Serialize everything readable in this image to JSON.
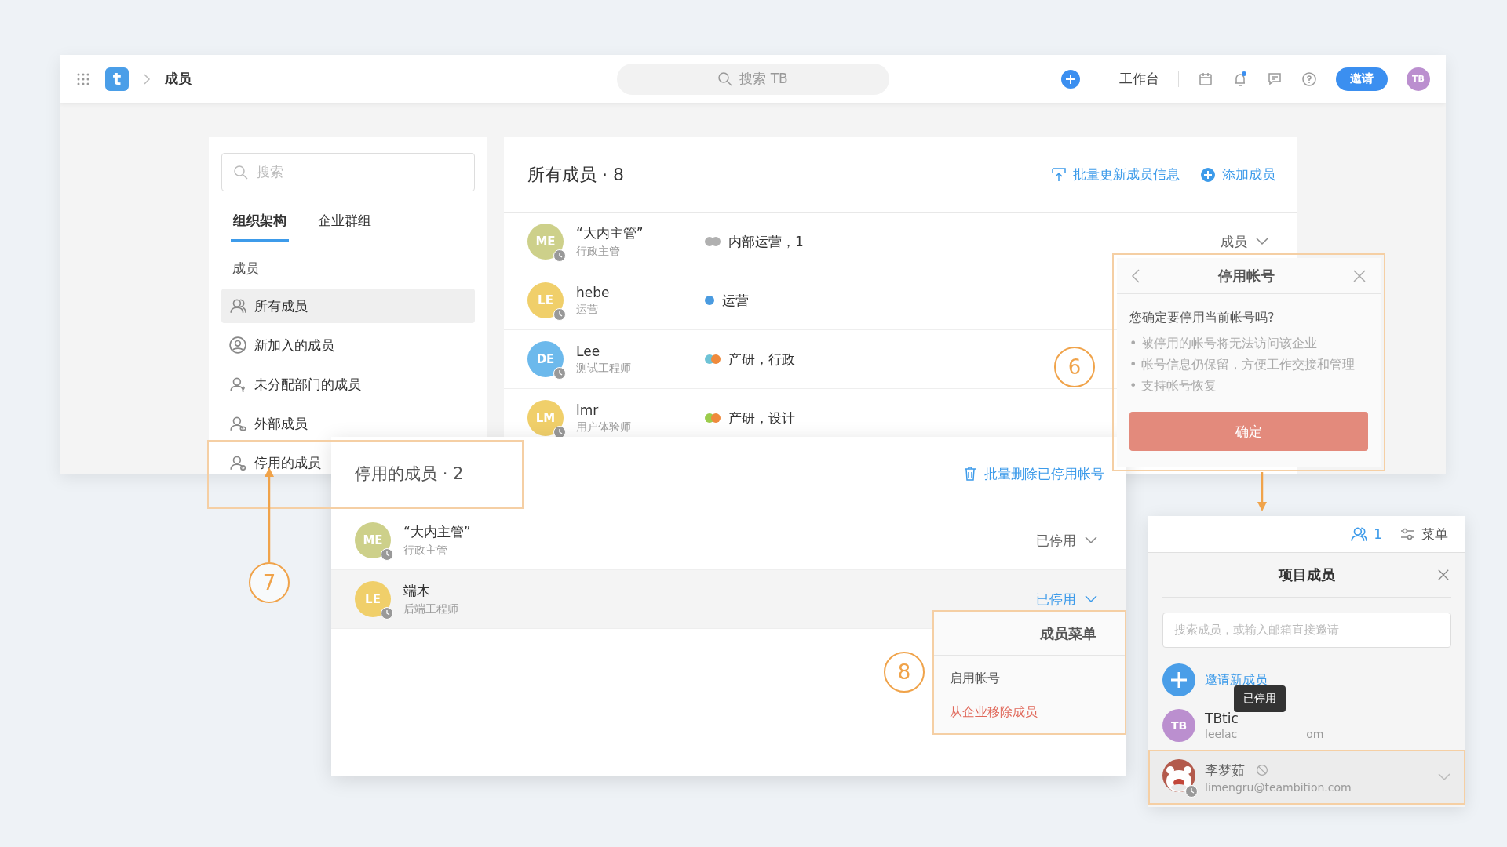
{
  "top_bar": {
    "logo": "t",
    "breadcrumb": "成员",
    "search_placeholder": "搜索 TB",
    "workbench": "工作台",
    "invite": "邀请",
    "avatar": "TB"
  },
  "sidebar": {
    "search_placeholder": "搜索",
    "tabs": [
      {
        "label": "组织架构",
        "selected": true
      },
      {
        "label": "企业群组",
        "selected": false
      }
    ],
    "section": "成员",
    "items": [
      {
        "label": "所有成员",
        "selected": true,
        "kind": "people"
      },
      {
        "label": "新加入的成员",
        "selected": false,
        "kind": "new"
      },
      {
        "label": "未分配部门的成员",
        "selected": false,
        "kind": "unassigned"
      },
      {
        "label": "外部成员",
        "selected": false,
        "kind": "external"
      },
      {
        "label": "停用的成员",
        "selected": false,
        "kind": "disabled"
      }
    ]
  },
  "members_panel": {
    "title": "所有成员 · 8",
    "actions": [
      {
        "label": "批量更新成员信息",
        "kind": "upload"
      },
      {
        "label": "添加成员",
        "kind": "add"
      }
    ],
    "rows": [
      {
        "initials": "ME",
        "color": "#cdd08a",
        "name": "“大内主管”",
        "title": "行政主管",
        "tags": [
          {
            "color": "#b0b0b0"
          },
          {
            "color": "#b0b0b0"
          }
        ],
        "departments": "内部运营，1",
        "role": "成员"
      },
      {
        "initials": "LE",
        "color": "#f0cf6a",
        "name": "hebe",
        "title": "运营",
        "tags": [
          {
            "color": "#4a9be0"
          }
        ],
        "departments": "运营"
      },
      {
        "initials": "DE",
        "color": "#6cb9ec",
        "name": "Lee",
        "title": "测试工程师",
        "tags": [
          {
            "color": "#6ec3d6"
          },
          {
            "color": "#ef8a3c"
          }
        ],
        "departments": "产研，行政"
      },
      {
        "initials": "LM",
        "color": "#f0cf6a",
        "name": "lmr",
        "title": "用户体验师",
        "tags": [
          {
            "color": "#9ccc4c"
          },
          {
            "color": "#ef8a3c"
          }
        ],
        "departments": "产研，设计"
      }
    ]
  },
  "disabled_panel": {
    "title": "停用的成员 · 2",
    "action": "批量删除已停用帐号",
    "rows": [
      {
        "initials": "ME",
        "color": "#cdd08a",
        "name": "“大内主管”",
        "title": "行政主管",
        "status": "已停用",
        "selected": false
      },
      {
        "initials": "LE",
        "color": "#f0cf6a",
        "name": "端木",
        "title": "后端工程师",
        "status": "已停用",
        "selected": true
      }
    ]
  },
  "deactivate_dialog": {
    "title": "停用帐号",
    "question": "您确定要停用当前帐号吗?",
    "bullets": [
      "• 被停用的帐号将无法访问该企业",
      "• 帐号信息仍保留，方便工作交接和管理",
      "• 支持帐号恢复"
    ],
    "confirm": "确定"
  },
  "member_menu": {
    "title": "成员菜单",
    "items": [
      {
        "label": "启用帐号",
        "kind": "normal"
      },
      {
        "label": "从企业移除成员",
        "kind": "danger"
      }
    ]
  },
  "project_panel": {
    "member_count": "1",
    "menu": "菜单",
    "title": "项目成员",
    "search_placeholder": "搜索成员，或输入邮箱直接邀请",
    "invite": "邀请新成员",
    "tooltip": "已停用",
    "members": [
      {
        "kind": "initials",
        "initials": "TB",
        "color": "#bb8fcf",
        "name": "TBtic",
        "email_start": "leelac",
        "email_end": "om",
        "disabled": false
      },
      {
        "kind": "picture",
        "name": "李梦茹",
        "email_start": "limengru@teambition.com",
        "disabled": true
      }
    ]
  },
  "annotations": [
    {
      "label": "6"
    },
    {
      "label": "7"
    },
    {
      "label": "8"
    }
  ]
}
